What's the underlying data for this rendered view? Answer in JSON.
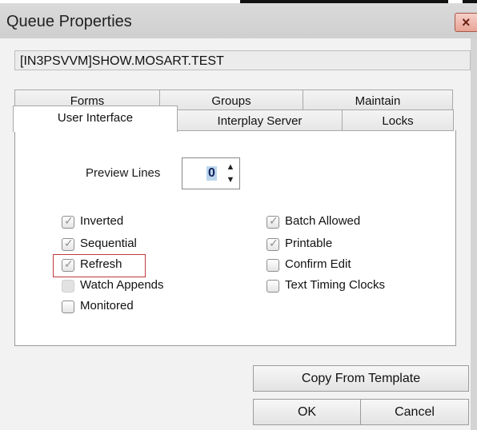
{
  "window": {
    "title": "Queue Properties",
    "close_glyph": "×"
  },
  "queue_path": "[IN3PSVVM]SHOW.MOSART.TEST",
  "tabs_back": [
    "Forms",
    "Groups",
    "Maintain"
  ],
  "tabs_front": [
    "User Interface",
    "Interplay Server",
    "Locks"
  ],
  "preview_lines": {
    "label": "Preview Lines",
    "value": "0"
  },
  "options_left": [
    {
      "label": "Inverted",
      "checked": true
    },
    {
      "label": "Sequential",
      "checked": true
    },
    {
      "label": "Refresh",
      "checked": true,
      "highlighted": true
    },
    {
      "label": "Watch Appends",
      "checked": false,
      "disabled": true
    },
    {
      "label": "Monitored",
      "checked": false
    }
  ],
  "options_right": [
    {
      "label": "Batch Allowed",
      "checked": true
    },
    {
      "label": "Printable",
      "checked": true
    },
    {
      "label": "Confirm Edit",
      "checked": false
    },
    {
      "label": "Text Timing Clocks",
      "checked": false
    }
  ],
  "buttons": {
    "copy_template": "Copy From Template",
    "ok": "OK",
    "cancel": "Cancel"
  },
  "icons": {
    "close": "close-icon",
    "spin_up": "up-arrow-icon",
    "spin_down": "down-arrow-icon",
    "check": "checkmark-icon"
  },
  "colors": {
    "highlight_box": "#c0383d",
    "selection": "#bcd6ee",
    "close_button": "#e8a395"
  }
}
